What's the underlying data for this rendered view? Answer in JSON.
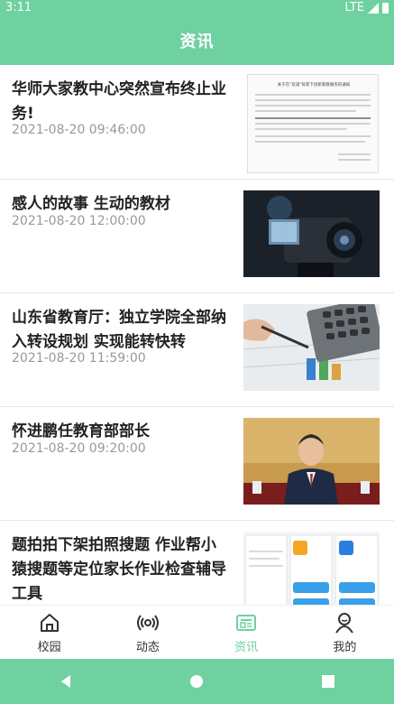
{
  "status": {
    "time": "3:11",
    "network": "LTE"
  },
  "header": {
    "title": "资讯"
  },
  "news": [
    {
      "title": "华师大家教中心突然宣布终止业务!",
      "date": "2021-08-20 09:46:00",
      "thumb": "notice-document-icon"
    },
    {
      "title": "感人的故事 生动的教材",
      "date": "2021-08-20 12:00:00",
      "thumb": "camera-photo"
    },
    {
      "title": "山东省教育厅：独立学院全部纳入转设规划 实现能转快转",
      "date": "2021-08-20 11:59:00",
      "thumb": "calculator-photo"
    },
    {
      "title": "怀进鹏任教育部部长",
      "date": "2021-08-20 09:20:00",
      "thumb": "portrait-photo"
    },
    {
      "title": "题拍拍下架拍照搜题 作业帮小猿搜题等定位家长作业检查辅导工具",
      "date": "",
      "thumb": "app-screenshots"
    }
  ],
  "thumb_text": {
    "notice_title": "关于在\"双减\"背景下创新家教服务的通知"
  },
  "tabs": [
    {
      "label": "校园",
      "icon": "home-icon"
    },
    {
      "label": "动态",
      "icon": "broadcast-icon"
    },
    {
      "label": "资讯",
      "icon": "news-icon",
      "active": true
    },
    {
      "label": "我的",
      "icon": "person-icon"
    }
  ],
  "colors": {
    "accent": "#6fd1a0"
  }
}
